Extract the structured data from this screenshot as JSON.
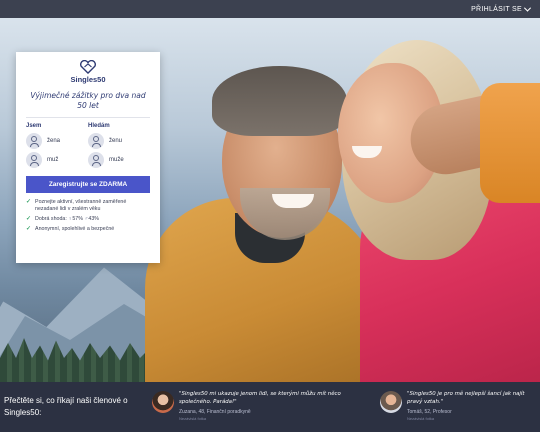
{
  "topbar": {
    "login_label": "PŘIHLÁSIT SE"
  },
  "card": {
    "logo_text": "Singles50",
    "tagline": "Výjimečné zážitky pro dva nad 50 let",
    "i_am_heading": "Jsem",
    "looking_heading": "Hledám",
    "i_am_options": [
      "žena",
      "muž"
    ],
    "looking_options": [
      "ženu",
      "muže"
    ],
    "cta_label": "Zaregistrujte se ZDARMA",
    "bullets": [
      "Poznejte aktivní, všestranně zaměřené nezadané lidi v zralém věku",
      "Dobrá shoda:",
      "Anonymní, spolehlivé a bezpečné"
    ],
    "match_women": "57%",
    "match_men": "43%"
  },
  "testimonials": {
    "title": "Přečtěte si, co říkají naši členové o Singles50:",
    "items": [
      {
        "quote": "\"Singles50 mi ukazuje jenom lidi, se kterými můžu mít něco společného. Paráda!\"",
        "author": "Zuzana, 48, Finanční poradkyně",
        "badge": "Nezávislá fotka"
      },
      {
        "quote": "\"Singles50 je pro mě nejlepší šancí jak najít pravý vztah.\"",
        "author": "Tomáš, 52, Profesor",
        "badge": "Nezávislá fotka"
      }
    ]
  },
  "colors": {
    "brand_navy": "#2f3b73",
    "cta_blue": "#4a55c9",
    "check_green": "#3aa56b",
    "topbar": "#3c4150",
    "testimonial_bar": "#2c3142"
  }
}
